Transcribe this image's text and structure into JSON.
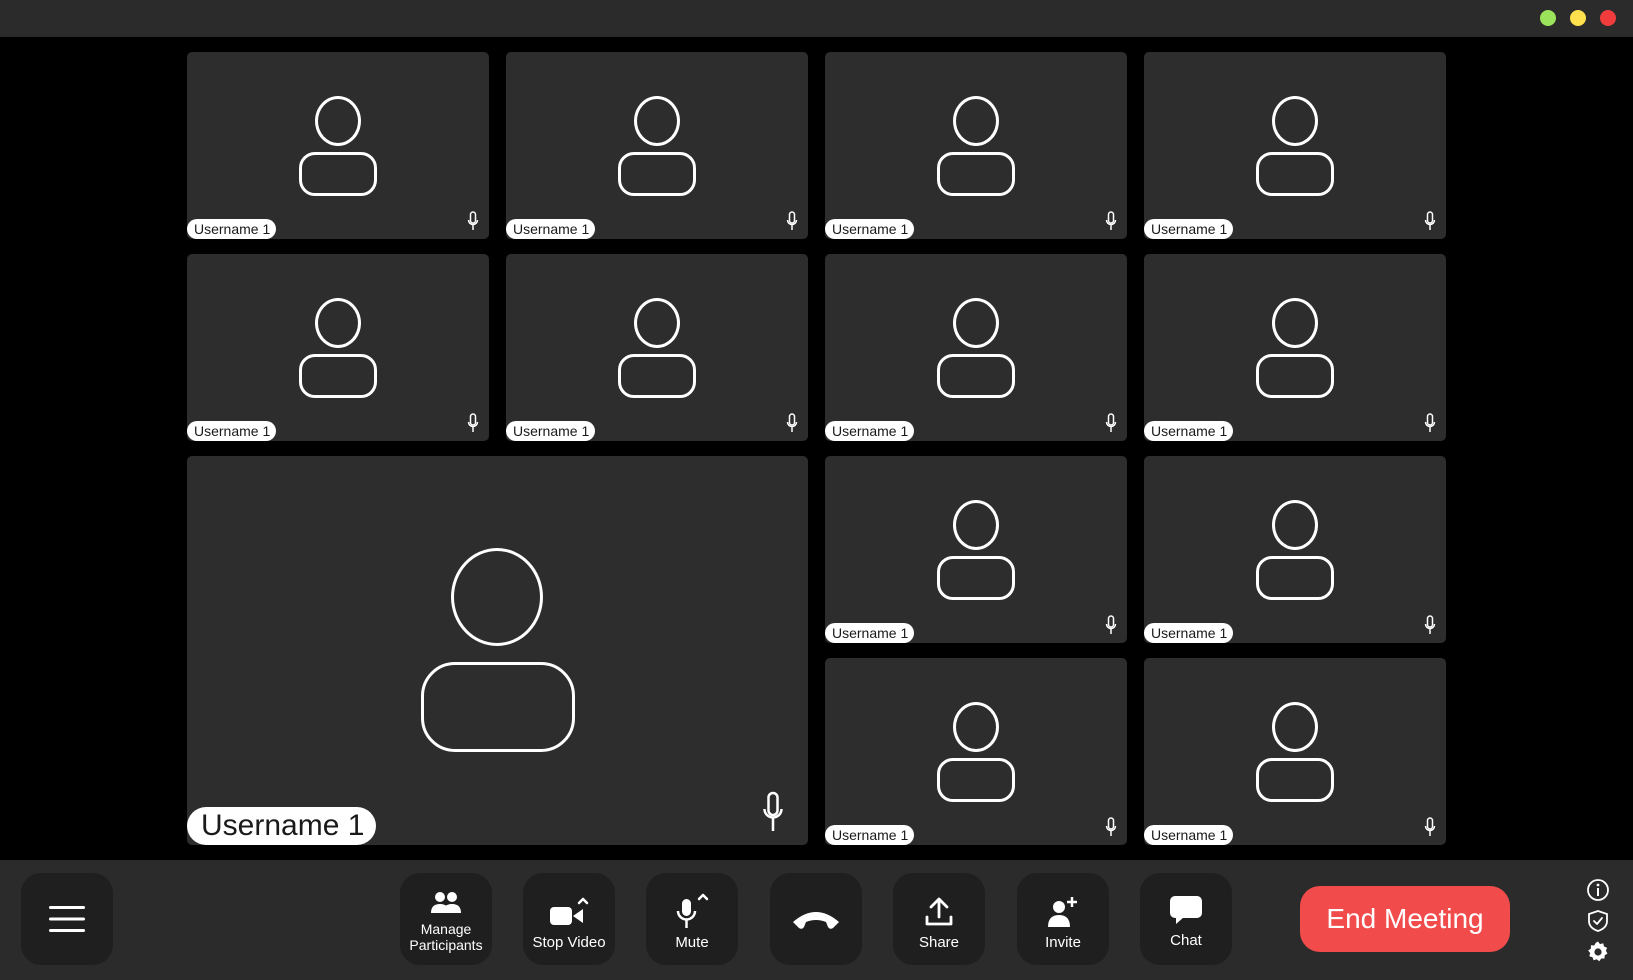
{
  "window": {
    "dots": [
      {
        "name": "maximize-dot",
        "color": "#9be35b"
      },
      {
        "name": "minimize-dot",
        "color": "#ffe14d"
      },
      {
        "name": "close-dot",
        "color": "#f03c3c"
      }
    ]
  },
  "participants": [
    {
      "name": "Username 1"
    },
    {
      "name": "Username 1"
    },
    {
      "name": "Username 1"
    },
    {
      "name": "Username 1"
    },
    {
      "name": "Username 1"
    },
    {
      "name": "Username 1"
    },
    {
      "name": "Username 1"
    },
    {
      "name": "Username 1"
    },
    {
      "name": "Username 1"
    },
    {
      "name": "Username 1"
    },
    {
      "name": "Username 1"
    },
    {
      "name": "Username 1"
    }
  ],
  "featured": {
    "name": "Username 1"
  },
  "toolbar": {
    "menu_icon": "hamburger-icon",
    "manage_participants_label": "Manage\nParticipants",
    "stop_video_label": "Stop Video",
    "mute_label": "Mute",
    "hangup_icon": "phone-hangup-icon",
    "share_label": "Share",
    "invite_label": "Invite",
    "chat_label": "Chat",
    "end_meeting_label": "End Meeting",
    "end_meeting_color": "#f24b4b"
  },
  "side_icons": [
    "info-icon",
    "shield-icon",
    "gear-icon"
  ]
}
